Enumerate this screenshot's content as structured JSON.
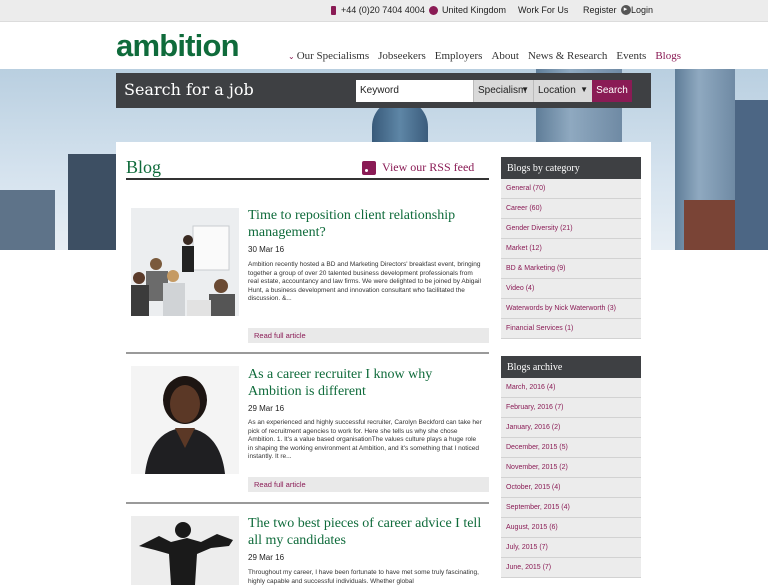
{
  "topbar": {
    "phone": "+44 (0)20 7404 4004",
    "region": "United Kingdom",
    "work_for_us": "Work For Us",
    "register": "Register",
    "login": "Login"
  },
  "header": {
    "logo": "ambition",
    "nav": [
      "Our Specialisms",
      "Jobseekers",
      "Employers",
      "About",
      "News & Research",
      "Events",
      "Blogs"
    ]
  },
  "search": {
    "title": "Search for a job",
    "keyword_placeholder": "Keyword",
    "specialism": "Specialism",
    "location": "Location",
    "button": "Search"
  },
  "blog": {
    "title": "Blog",
    "rss": "View our RSS feed",
    "read_more": "Read full article",
    "articles": [
      {
        "title": "Time to reposition client relationship management?",
        "date": "30 Mar 16",
        "excerpt": "Ambition recently hosted a BD and Marketing Directors' breakfast event, bringing together a group of over 20 talented business development professionals from real estate, accountancy and law firms.   We were delighted to be joined by Abigail Hunt, a business development and innovation consultant who facilitated the discussion. &..."
      },
      {
        "title": "As a career recruiter I know why Ambition is different",
        "date": "29 Mar 16",
        "excerpt": "As an experienced and highly successful recruiter, Carolyn Beckford can take her pick of recruitment agencies to work for. Here she tells us why she chose Ambition. 1. It's a value based organisationThe values culture plays a huge role in shaping the working environment at Ambition, and it's something that I noticed instantly. It re..."
      },
      {
        "title": "The two best pieces of career advice I tell all my candidates",
        "date": "29 Mar 16",
        "excerpt": "Throughout my career, I have been fortunate to have met some truly fascinating, highly capable and successful individuals. Whether global"
      }
    ]
  },
  "sidebar": {
    "categories_title": "Blogs by category",
    "categories": [
      "General (70)",
      "Career (60)",
      "Gender Diversity (21)",
      "Market (12)",
      "BD & Marketing (9)",
      "Video (4)",
      "Waterwords by Nick Waterworth (3)",
      "Financial Services (1)"
    ],
    "archive_title": "Blogs archive",
    "archive": [
      "March, 2016 (4)",
      "February, 2016 (7)",
      "January, 2016 (2)",
      "December, 2015 (5)",
      "November, 2015 (2)",
      "October, 2015 (4)",
      "September, 2015 (4)",
      "August, 2015 (6)",
      "July, 2015 (7)",
      "June, 2015 (7)"
    ]
  },
  "colors": {
    "brand_green": "#0f6b3b",
    "accent_plum": "#8a1b55",
    "dark_bar": "#3e4043"
  }
}
